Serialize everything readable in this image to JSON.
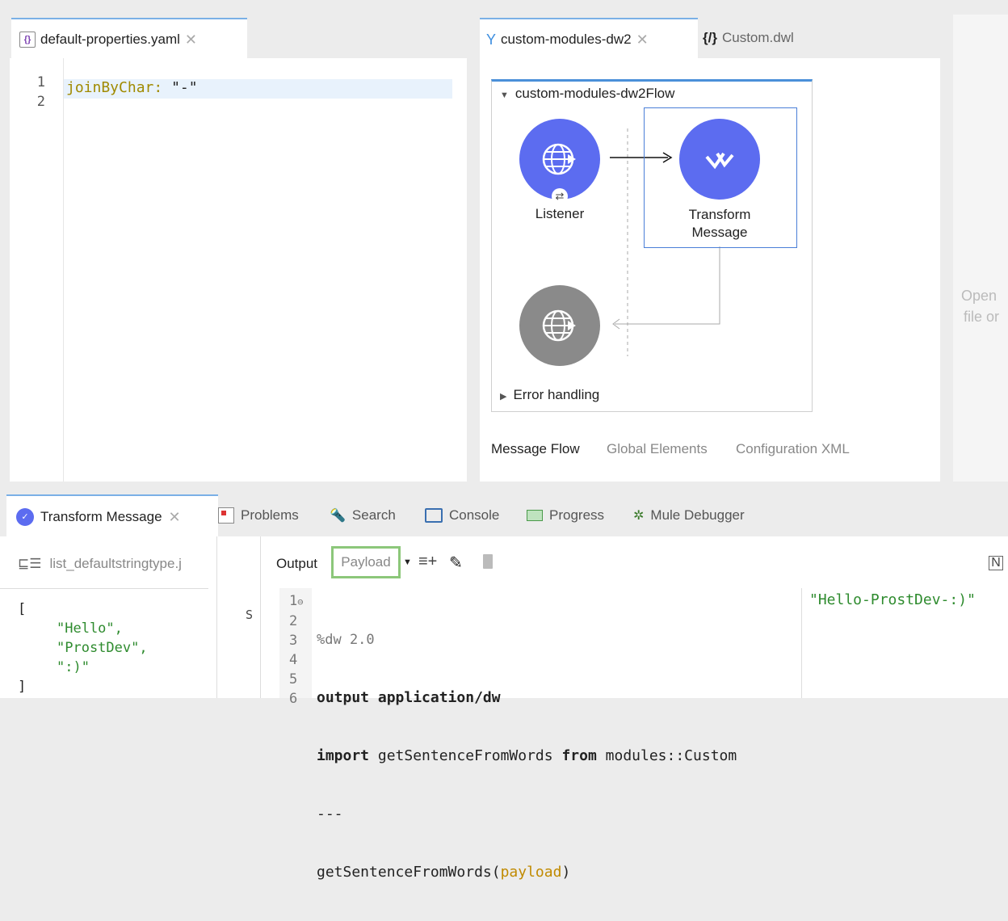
{
  "left_editor": {
    "tab_label": "default-properties.yaml",
    "line_numbers": [
      "1",
      "2"
    ],
    "code": {
      "key": "joinByChar:",
      "value": "\"-\""
    }
  },
  "center": {
    "tabs": [
      {
        "label": "custom-modules-dw2"
      },
      {
        "label": "Custom.dwl",
        "icon": "{/}"
      }
    ],
    "flow": {
      "title": "custom-modules-dw2Flow",
      "listener_label": "Listener",
      "transform_label_1": "Transform",
      "transform_label_2": "Message",
      "error_label": "Error handling"
    },
    "bottom_tabs": [
      "Message Flow",
      "Global Elements",
      "Configuration XML"
    ]
  },
  "right_strip": {
    "text1": "Open",
    "text2": "file or"
  },
  "bottom_tabs": [
    {
      "label": "Transform Message"
    },
    {
      "label": "Problems"
    },
    {
      "label": "Search"
    },
    {
      "label": "Console"
    },
    {
      "label": "Progress"
    },
    {
      "label": "Mule Debugger"
    }
  ],
  "input_panel": {
    "file_label": "list_defaultstringtype.j",
    "lines": [
      "[",
      "\"Hello\",",
      "\"ProstDev\",",
      "\":)\"",
      "]"
    ]
  },
  "middle_marker": "S",
  "output_panel": {
    "label": "Output",
    "target": "Payload",
    "line_numbers": [
      "1",
      "2",
      "3",
      "4",
      "5",
      "6"
    ],
    "lines": [
      "%dw 2.0",
      "output application/dw",
      "import getSentenceFromWords from modules::Custom",
      "---",
      "getSentenceFromWords(payload)"
    ],
    "kw_output": "output application/dw",
    "kw_import": "import",
    "import_rest": " getSentenceFromWords ",
    "kw_from": "from",
    "from_rest": " modules::Custom",
    "call_fn": "getSentenceFromWords(",
    "call_arg": "payload",
    "call_close": ")",
    "preview": "\"Hello-ProstDev-:)\""
  },
  "colors": {
    "accent": "#5c6cf0",
    "selection_border": "#4a7fd8",
    "payload_border": "#8cc77a",
    "string_green": "#2e8b2e",
    "key_yellow": "#a08a00"
  }
}
